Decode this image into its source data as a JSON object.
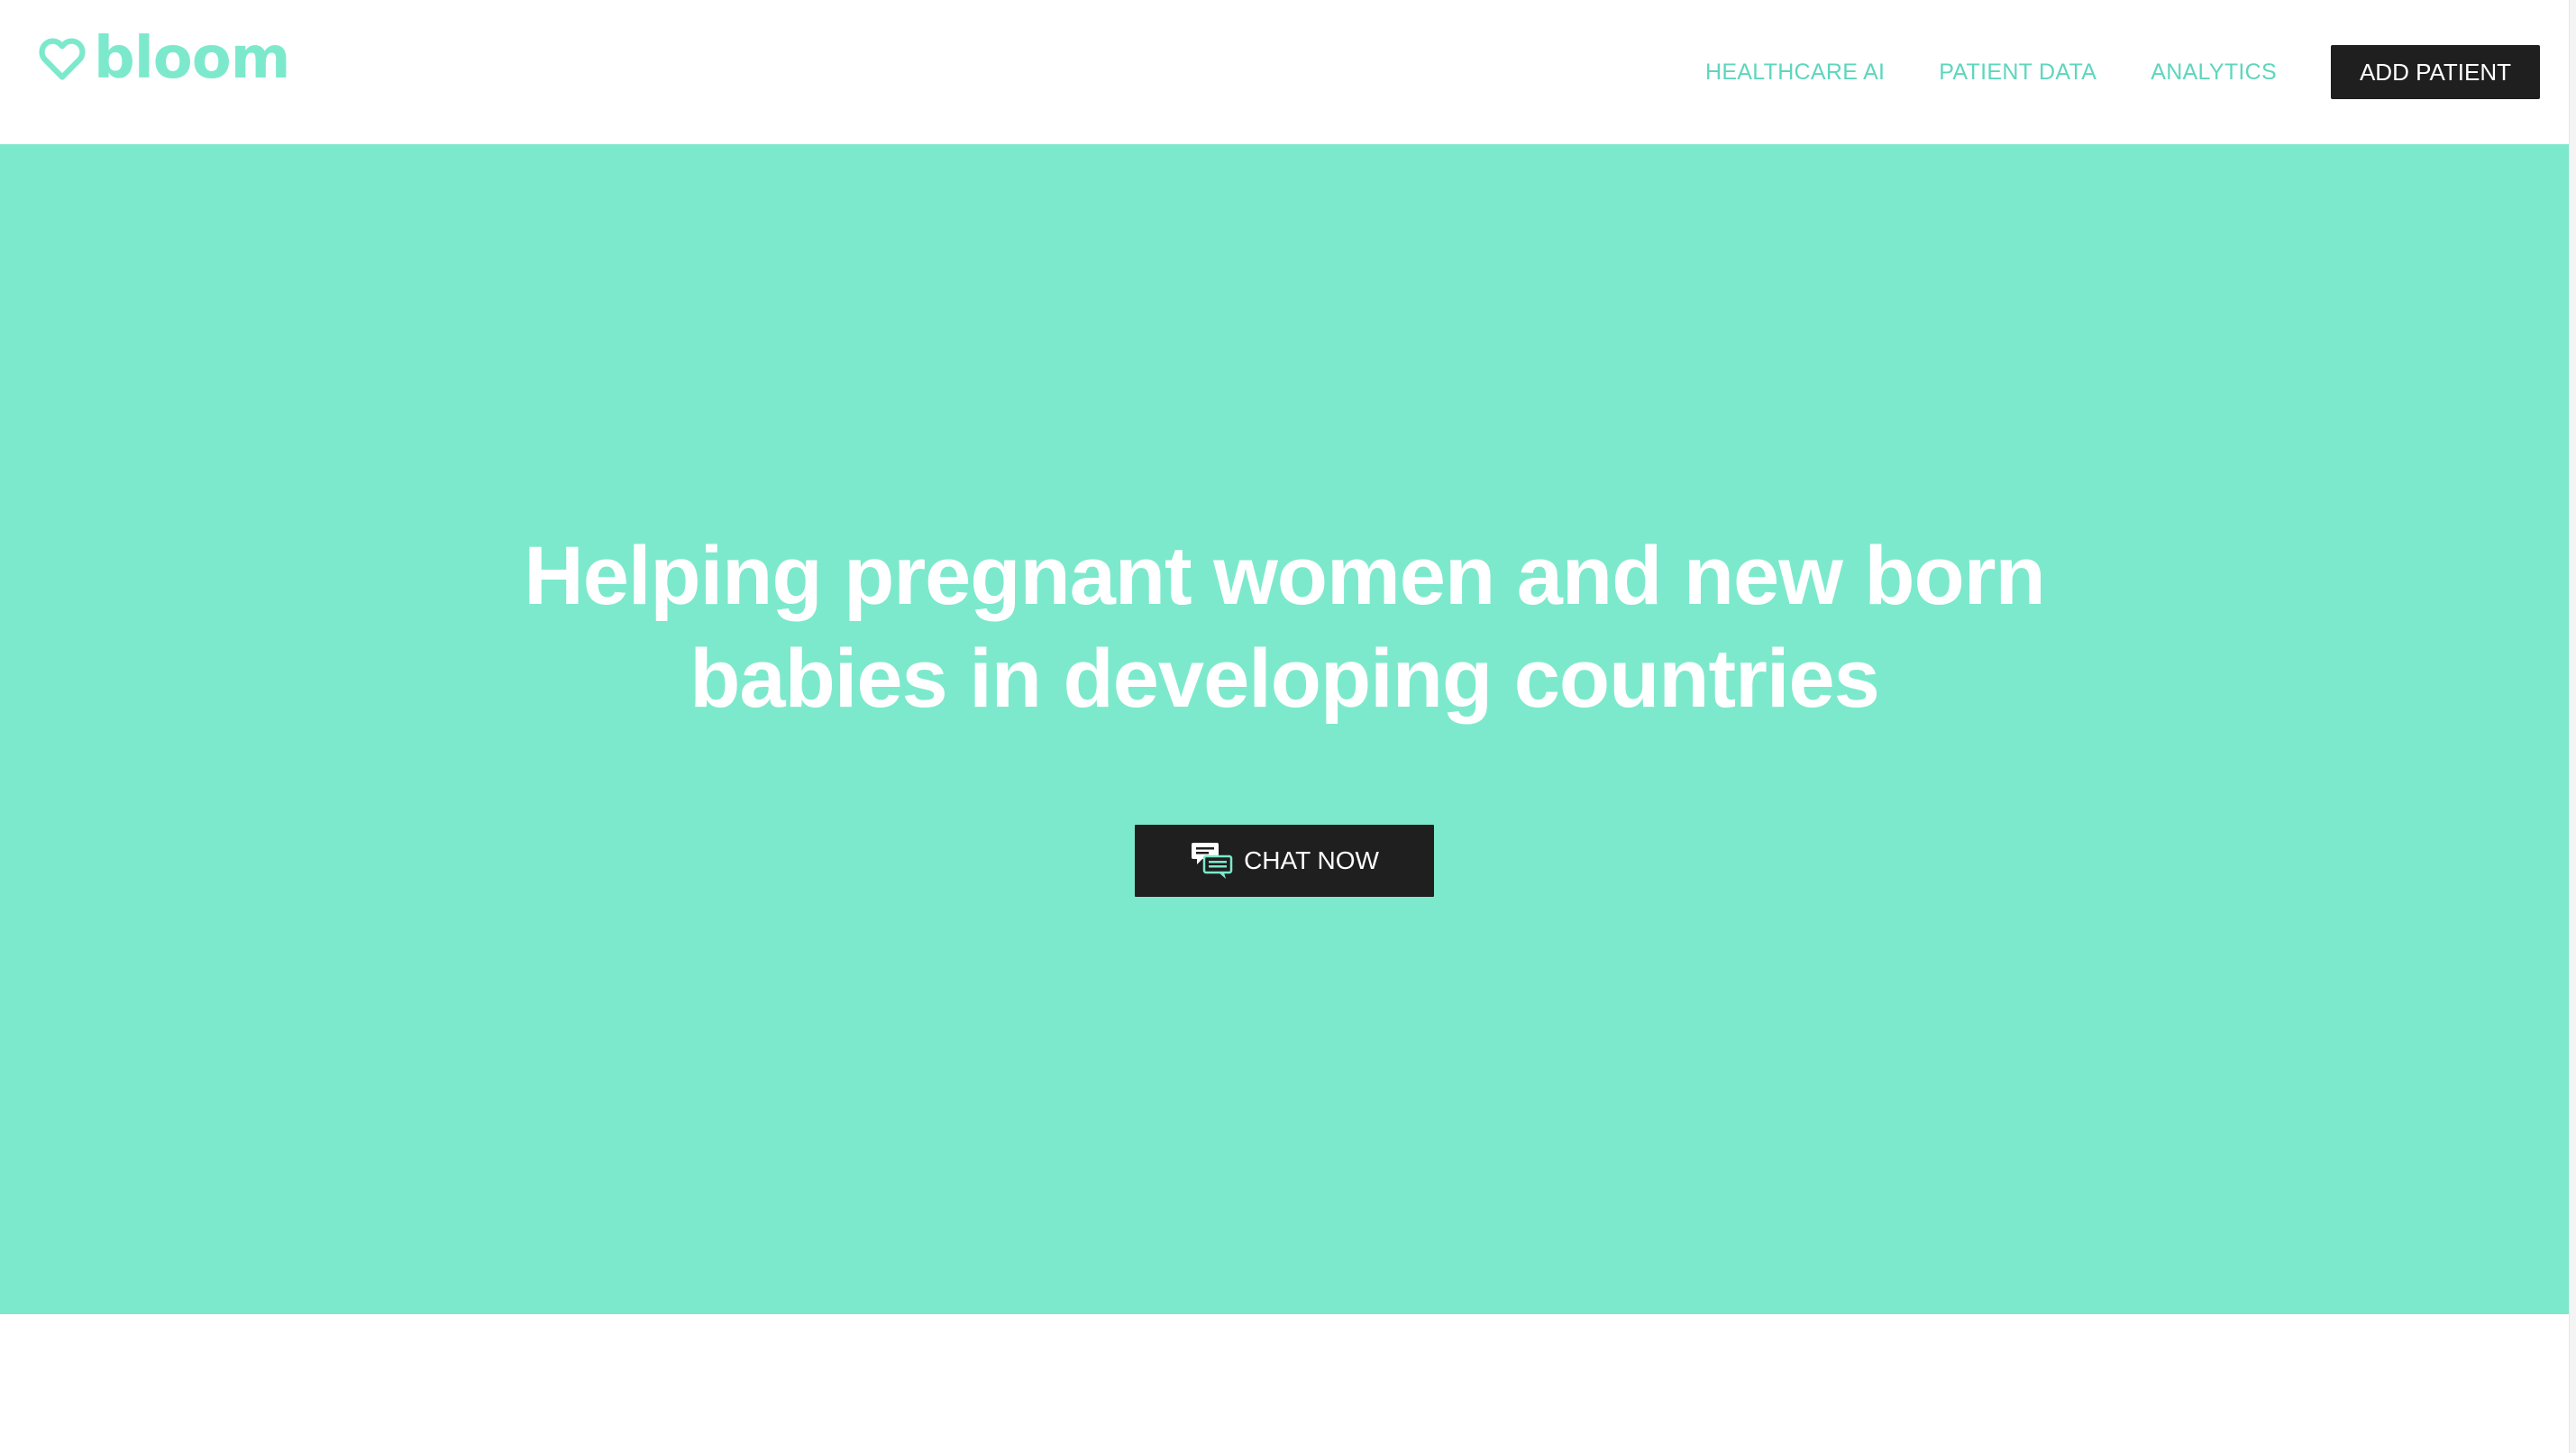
{
  "brand": {
    "name": "bloom",
    "color": "#7de9cc",
    "icon": "heart-outline-icon"
  },
  "nav": {
    "links": [
      {
        "label": "HEALTHCARE AI"
      },
      {
        "label": "PATIENT DATA"
      },
      {
        "label": "ANALYTICS"
      }
    ],
    "cta_label": "ADD PATIENT",
    "link_color": "#5ed6bd"
  },
  "hero": {
    "title_line1": "Helping pregnant women and new born",
    "title_line2": "babies in developing countries",
    "background": "#7de9cc",
    "cta": {
      "label": "CHAT NOW",
      "icon": "chat-bubbles-icon"
    }
  },
  "colors": {
    "dark_button": "#1f1f1f",
    "text_on_accent": "#ffffff"
  }
}
